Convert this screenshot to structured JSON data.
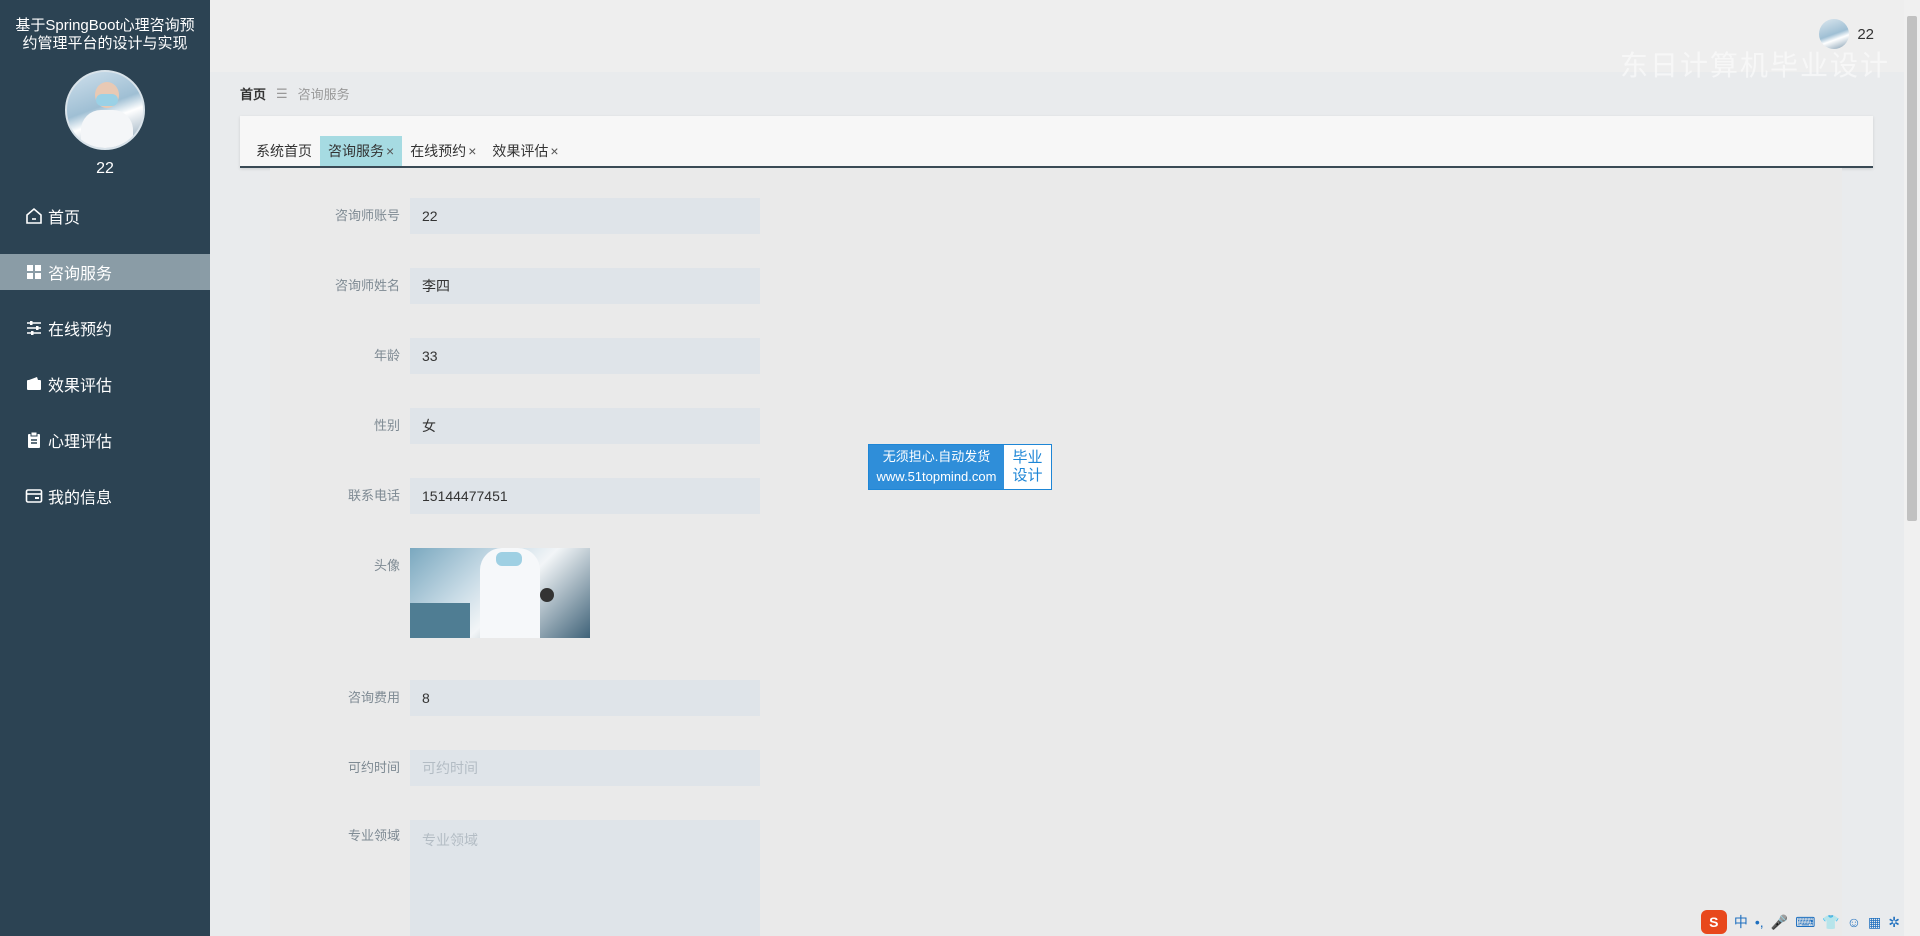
{
  "app": {
    "title": "基于SpringBoot心理咨询预约管理平台的设计与实现",
    "user_name": "22"
  },
  "sidebar": {
    "items": [
      {
        "label": "首页",
        "icon": "home-icon"
      },
      {
        "label": "咨询服务",
        "icon": "grid-icon"
      },
      {
        "label": "在线预约",
        "icon": "sliders-icon"
      },
      {
        "label": "效果评估",
        "icon": "wallet-icon"
      },
      {
        "label": "心理评估",
        "icon": "clipboard-icon"
      },
      {
        "label": "我的信息",
        "icon": "card-icon"
      }
    ],
    "active_index": 1
  },
  "header": {
    "user_name": "22",
    "watermark": "东日计算机毕业设计"
  },
  "breadcrumb": {
    "home": "首页",
    "separator": "☰",
    "current": "咨询服务"
  },
  "tabs": [
    {
      "label": "系统首页",
      "closable": false
    },
    {
      "label": "咨询服务",
      "closable": true,
      "active": true
    },
    {
      "label": "在线预约",
      "closable": true
    },
    {
      "label": "效果评估",
      "closable": true
    }
  ],
  "form": {
    "account": {
      "label": "咨询师账号",
      "value": "22"
    },
    "name": {
      "label": "咨询师姓名",
      "value": "李四"
    },
    "age": {
      "label": "年龄",
      "value": "33"
    },
    "gender": {
      "label": "性别",
      "value": "女"
    },
    "phone": {
      "label": "联系电话",
      "value": "15144477451"
    },
    "avatar": {
      "label": "头像"
    },
    "fee": {
      "label": "咨询费用",
      "value": "8"
    },
    "available_time": {
      "label": "可约时间",
      "placeholder": "可约时间"
    },
    "specialty": {
      "label": "专业领域",
      "placeholder": "专业领域"
    }
  },
  "ad": {
    "line1": "无须担心.自动发货",
    "line2": "www.51topmind.com",
    "right1": "毕业",
    "right2": "设计"
  },
  "ime": {
    "logo": "S",
    "mode": "中",
    "punct": "•,"
  },
  "colors": {
    "sidebar_bg": "#2c4353",
    "sidebar_active": "#8a9ca6",
    "tab_active": "#a6dbe2",
    "input_bg": "#dfe4e9"
  }
}
